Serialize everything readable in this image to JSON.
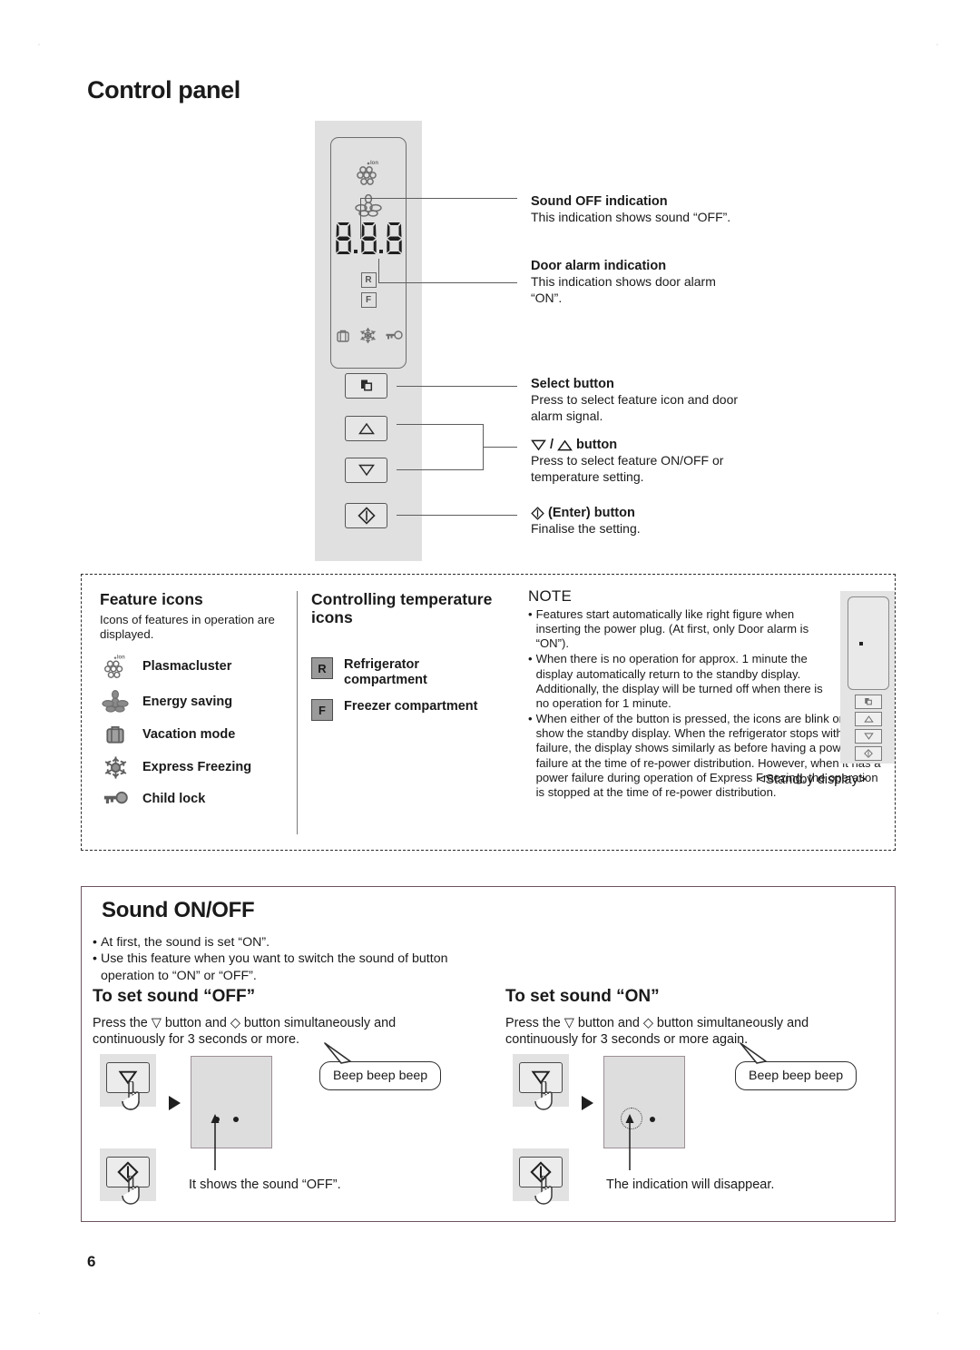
{
  "page": {
    "title": "Control panel",
    "number": "6"
  },
  "callouts": [
    {
      "id": "sound-off-indication",
      "title": "Sound OFF indication",
      "body": "This indication shows sound “OFF”."
    },
    {
      "id": "door-alarm-indication",
      "title": "Door alarm indication",
      "body": "This indication shows door alarm “ON”."
    },
    {
      "id": "select-button",
      "title": "Select button",
      "body": "Press to select feature icon and door alarm signal."
    },
    {
      "id": "updown-button",
      "title": "button",
      "body": "Press to select feature ON/OFF or temperature setting."
    },
    {
      "id": "enter-button",
      "title": "(Enter) button",
      "body": "Finalise the setting."
    }
  ],
  "panel": {
    "display_digits": "8.8.8",
    "badges": [
      "R",
      "F"
    ],
    "icons": [
      "plasmacluster-icon",
      "energy-saving-icon",
      "vacation-mode-icon",
      "express-freezing-icon",
      "child-lock-icon"
    ],
    "buttons": [
      "select-icon",
      "up-arrow-icon",
      "down-arrow-icon",
      "enter-icon"
    ]
  },
  "feature_icons": {
    "heading": "Feature icons",
    "sub": "Icons of features in operation are displayed.",
    "items": [
      {
        "icon": "plasmacluster-icon",
        "label": "Plasmacluster"
      },
      {
        "icon": "energy-saving-icon",
        "label": "Energy saving"
      },
      {
        "icon": "vacation-mode-icon",
        "label": "Vacation mode"
      },
      {
        "icon": "express-freezing-icon",
        "label": "Express Freezing"
      },
      {
        "icon": "child-lock-icon",
        "label": "Child lock"
      }
    ]
  },
  "temperature_icons": {
    "heading": "Controlling temperature icons",
    "items": [
      {
        "badge": "R",
        "label": "Refrigerator compartment"
      },
      {
        "badge": "F",
        "label": "Freezer compartment"
      }
    ]
  },
  "note": {
    "heading": "NOTE",
    "bullets": [
      "Features start automatically like right figure when inserting the power plug. (At first, only Door alarm is “ON”).",
      "When there is no operation for approx. 1 minute the display automatically return to the standby display. Additionally, the display will be turned off when there is no operation for 1 minute.",
      "When either of the button is pressed, the icons are blink once and show the standby display. When the refrigerator stops with power failure, the display shows similarly as before having a power failure at the time of re-power distribution. However, when it has a power failure during operation of Express Freezing, the operation is stopped at the time of re-power distribution."
    ],
    "standby_caption": "<Standby display>"
  },
  "sound_section": {
    "title": "Sound ON/OFF",
    "bullets": [
      "At first, the sound is set “ON”.",
      "Use this feature when you want to switch the sound of button operation to “ON” or “OFF”."
    ],
    "off": {
      "heading": "To set sound “OFF”",
      "body": "Press the ▽ button and ◇ button simultaneously and continuously for 3 seconds or more.",
      "bubble": "Beep beep beep",
      "caption": "It shows the sound “OFF”."
    },
    "on": {
      "heading": "To set sound “ON”",
      "body": "Press the ▽ button and ◇ button simultaneously and continuously for 3 seconds or more again.",
      "bubble": "Beep beep beep",
      "caption": "The indication will disappear."
    }
  },
  "colors": {
    "panel_bg": "#e0e0e0",
    "icon_gray": "#7a7a7a",
    "border": "#6b5560",
    "text": "#1a1a1a"
  }
}
